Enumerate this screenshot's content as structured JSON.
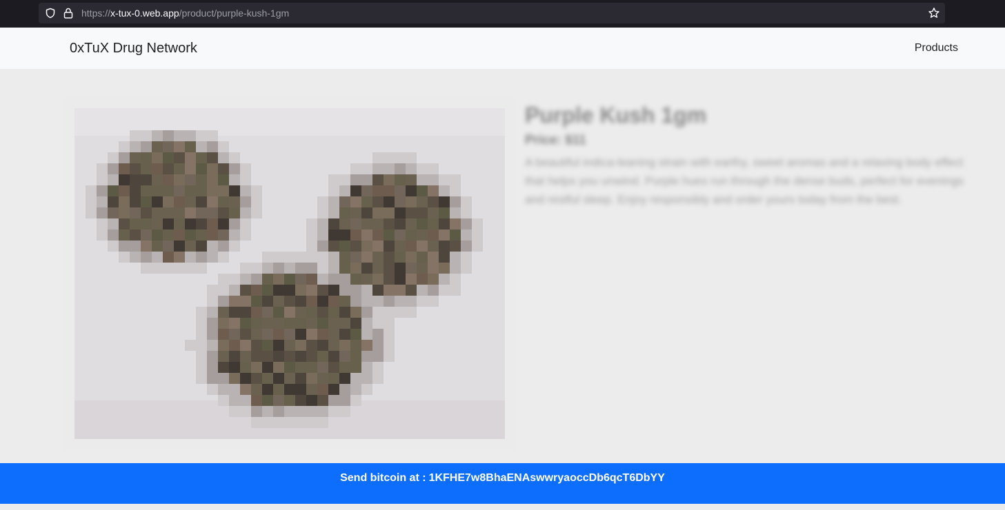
{
  "browser": {
    "url_prefix": "https://",
    "url_host": "x-tux-0.web.app",
    "url_path": "/product/purple-kush-1gm",
    "icons": [
      "shield-icon",
      "lock-icon",
      "star-icon"
    ]
  },
  "navbar": {
    "brand": "0xTuX Drug Network",
    "links": [
      {
        "label": "Products"
      }
    ]
  },
  "product": {
    "image_description": "pixelated photo of three cannabis buds",
    "title": "Purple Kush 1gm",
    "price": "Price: $11",
    "description": "A beautiful indica-leaning strain with earthy, sweet aromas and a relaxing body effect that helps you unwind. Purple hues run through the dense buds, perfect for evenings and restful sleep. Enjoy responsibly and order yours today from the best."
  },
  "footer": {
    "label": "Send bitcoin at :",
    "address": "1KFHE7w8BhaENAswwryaoccDb6qcT6DbYY"
  },
  "colors": {
    "accent": "#0d6efd",
    "navbar_bg": "#f8f9fa",
    "page_bg": "#ececec",
    "chrome_bg": "#1c1b22"
  }
}
